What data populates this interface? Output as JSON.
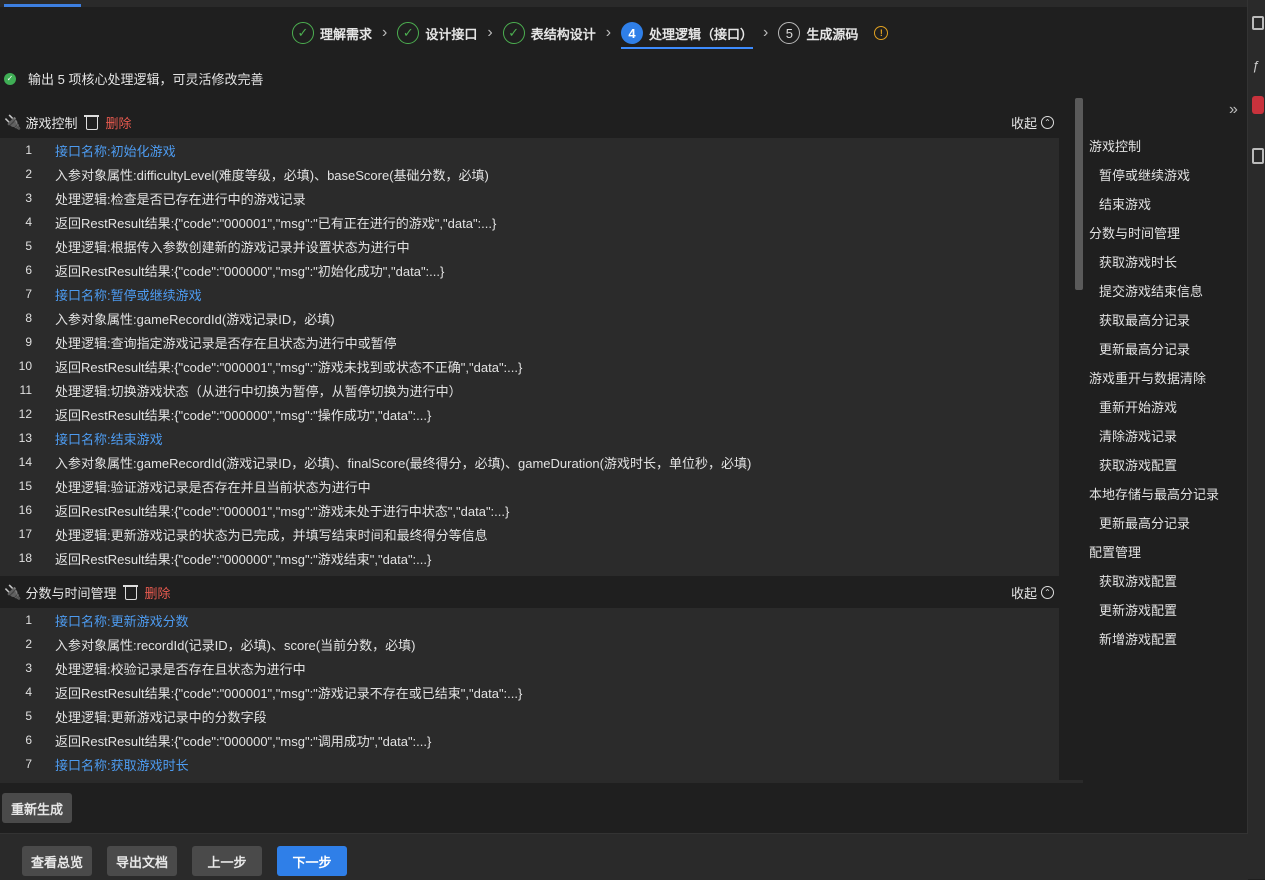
{
  "steps": [
    {
      "num": "✓",
      "label": "理解需求",
      "state": "done"
    },
    {
      "num": "✓",
      "label": "设计接口",
      "state": "done"
    },
    {
      "num": "✓",
      "label": "表结构设计",
      "state": "done"
    },
    {
      "num": "4",
      "label": "处理逻辑（接口）",
      "state": "active"
    },
    {
      "num": "5",
      "label": "生成源码",
      "state": "todo"
    }
  ],
  "status_message": "输出 5 项核心处理逻辑，可灵活修改完善",
  "sections": [
    {
      "title": "游戏控制",
      "delete_label": "删除",
      "collapse_label": "收起",
      "lines": [
        {
          "n": "1",
          "text": "接口名称:初始化游戏",
          "api": true
        },
        {
          "n": "2",
          "text": "入参对象属性:difficultyLevel(难度等级，必填)、baseScore(基础分数，必填)"
        },
        {
          "n": "3",
          "text": "处理逻辑:检查是否已存在进行中的游戏记录"
        },
        {
          "n": "4",
          "text": "返回RestResult结果:{\"code\":\"000001\",\"msg\":\"已有正在进行的游戏\",\"data\":...}"
        },
        {
          "n": "5",
          "text": "处理逻辑:根据传入参数创建新的游戏记录并设置状态为进行中"
        },
        {
          "n": "6",
          "text": "返回RestResult结果:{\"code\":\"000000\",\"msg\":\"初始化成功\",\"data\":...}"
        },
        {
          "n": "7",
          "text": "接口名称:暂停或继续游戏",
          "api": true
        },
        {
          "n": "8",
          "text": "入参对象属性:gameRecordId(游戏记录ID，必填)"
        },
        {
          "n": "9",
          "text": "处理逻辑:查询指定游戏记录是否存在且状态为进行中或暂停"
        },
        {
          "n": "10",
          "text": "返回RestResult结果:{\"code\":\"000001\",\"msg\":\"游戏未找到或状态不正确\",\"data\":...}"
        },
        {
          "n": "11",
          "text": "处理逻辑:切换游戏状态（从进行中切换为暂停，从暂停切换为进行中）"
        },
        {
          "n": "12",
          "text": "返回RestResult结果:{\"code\":\"000000\",\"msg\":\"操作成功\",\"data\":...}"
        },
        {
          "n": "13",
          "text": "接口名称:结束游戏",
          "api": true
        },
        {
          "n": "14",
          "text": "入参对象属性:gameRecordId(游戏记录ID，必填)、finalScore(最终得分，必填)、gameDuration(游戏时长，单位秒，必填)"
        },
        {
          "n": "15",
          "text": "处理逻辑:验证游戏记录是否存在并且当前状态为进行中"
        },
        {
          "n": "16",
          "text": "返回RestResult结果:{\"code\":\"000001\",\"msg\":\"游戏未处于进行中状态\",\"data\":...}"
        },
        {
          "n": "17",
          "text": "处理逻辑:更新游戏记录的状态为已完成，并填写结束时间和最终得分等信息"
        },
        {
          "n": "18",
          "text": "返回RestResult结果:{\"code\":\"000000\",\"msg\":\"游戏结束\",\"data\":...}"
        }
      ]
    },
    {
      "title": "分数与时间管理",
      "delete_label": "删除",
      "collapse_label": "收起",
      "lines": [
        {
          "n": "1",
          "text": "接口名称:更新游戏分数",
          "api": true
        },
        {
          "n": "2",
          "text": "入参对象属性:recordId(记录ID，必填)、score(当前分数，必填)"
        },
        {
          "n": "3",
          "text": "处理逻辑:校验记录是否存在且状态为进行中"
        },
        {
          "n": "4",
          "text": "返回RestResult结果:{\"code\":\"000001\",\"msg\":\"游戏记录不存在或已结束\",\"data\":...}"
        },
        {
          "n": "5",
          "text": "处理逻辑:更新游戏记录中的分数字段"
        },
        {
          "n": "6",
          "text": "返回RestResult结果:{\"code\":\"000000\",\"msg\":\"调用成功\",\"data\":...}"
        },
        {
          "n": "7",
          "text": "接口名称:获取游戏时长",
          "api": true
        }
      ]
    }
  ],
  "toc": [
    {
      "label": "游戏控制",
      "level": 0
    },
    {
      "label": "暂停或继续游戏",
      "level": 1
    },
    {
      "label": "结束游戏",
      "level": 1
    },
    {
      "label": "分数与时间管理",
      "level": 0
    },
    {
      "label": "获取游戏时长",
      "level": 1
    },
    {
      "label": "提交游戏结束信息",
      "level": 1
    },
    {
      "label": "获取最高分记录",
      "level": 1
    },
    {
      "label": "更新最高分记录",
      "level": 1
    },
    {
      "label": "游戏重开与数据清除",
      "level": 0
    },
    {
      "label": "重新开始游戏",
      "level": 1
    },
    {
      "label": "清除游戏记录",
      "level": 1
    },
    {
      "label": "获取游戏配置",
      "level": 1
    },
    {
      "label": "本地存储与最高分记录",
      "level": 0
    },
    {
      "label": "更新最高分记录",
      "level": 1
    },
    {
      "label": "配置管理",
      "level": 0
    },
    {
      "label": "获取游戏配置",
      "level": 1
    },
    {
      "label": "更新游戏配置",
      "level": 1
    },
    {
      "label": "新增游戏配置",
      "level": 1
    }
  ],
  "buttons": {
    "regenerate": "重新生成",
    "overview": "查看总览",
    "export": "导出文档",
    "prev": "上一步",
    "next": "下一步"
  },
  "colors": {
    "accent": "#2f7fe8",
    "done": "#4caf50",
    "delete": "#e85a4f",
    "api_line": "#4d9bf0",
    "warning": "#e0a020"
  }
}
